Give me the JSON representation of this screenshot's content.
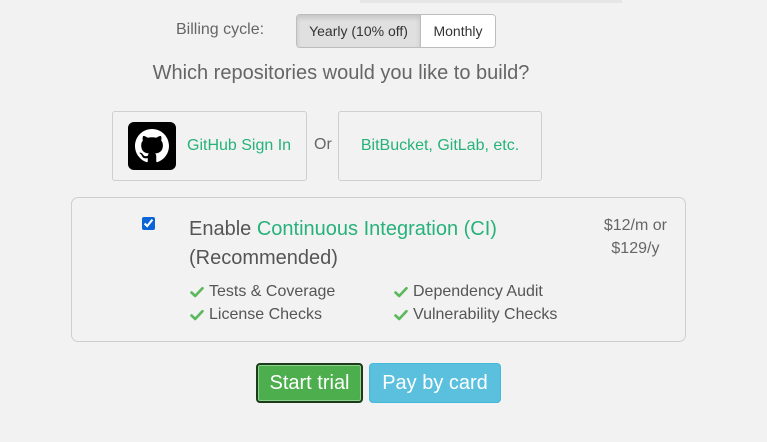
{
  "billing": {
    "label": "Billing cycle:",
    "options": [
      "Yearly (10% off)",
      "Monthly"
    ],
    "selected": "Yearly (10% off)"
  },
  "question": "Which repositories would you like to build?",
  "providers": {
    "github_label": "GitHub Sign In",
    "or_text": "Or",
    "other_label": "BitBucket, GitLab, etc."
  },
  "ci": {
    "checked": true,
    "prefix": "Enable ",
    "accent_text": "Continuous Integration (CI)",
    "suffix": "(Recommended)",
    "price_monthly": "$12/m or",
    "price_yearly": "$129/y",
    "features": [
      "Tests & Coverage",
      "Dependency Audit",
      "License Checks",
      "Vulnerability Checks"
    ]
  },
  "actions": {
    "start_label": "Start trial",
    "pay_label": "Pay by card"
  },
  "colors": {
    "accent_green": "#27b27a",
    "check_green": "#5cb85c",
    "start_button": "#4cae4c",
    "pay_button": "#5bc0de"
  },
  "icons": {
    "github": "github-icon",
    "check": "check-icon"
  }
}
